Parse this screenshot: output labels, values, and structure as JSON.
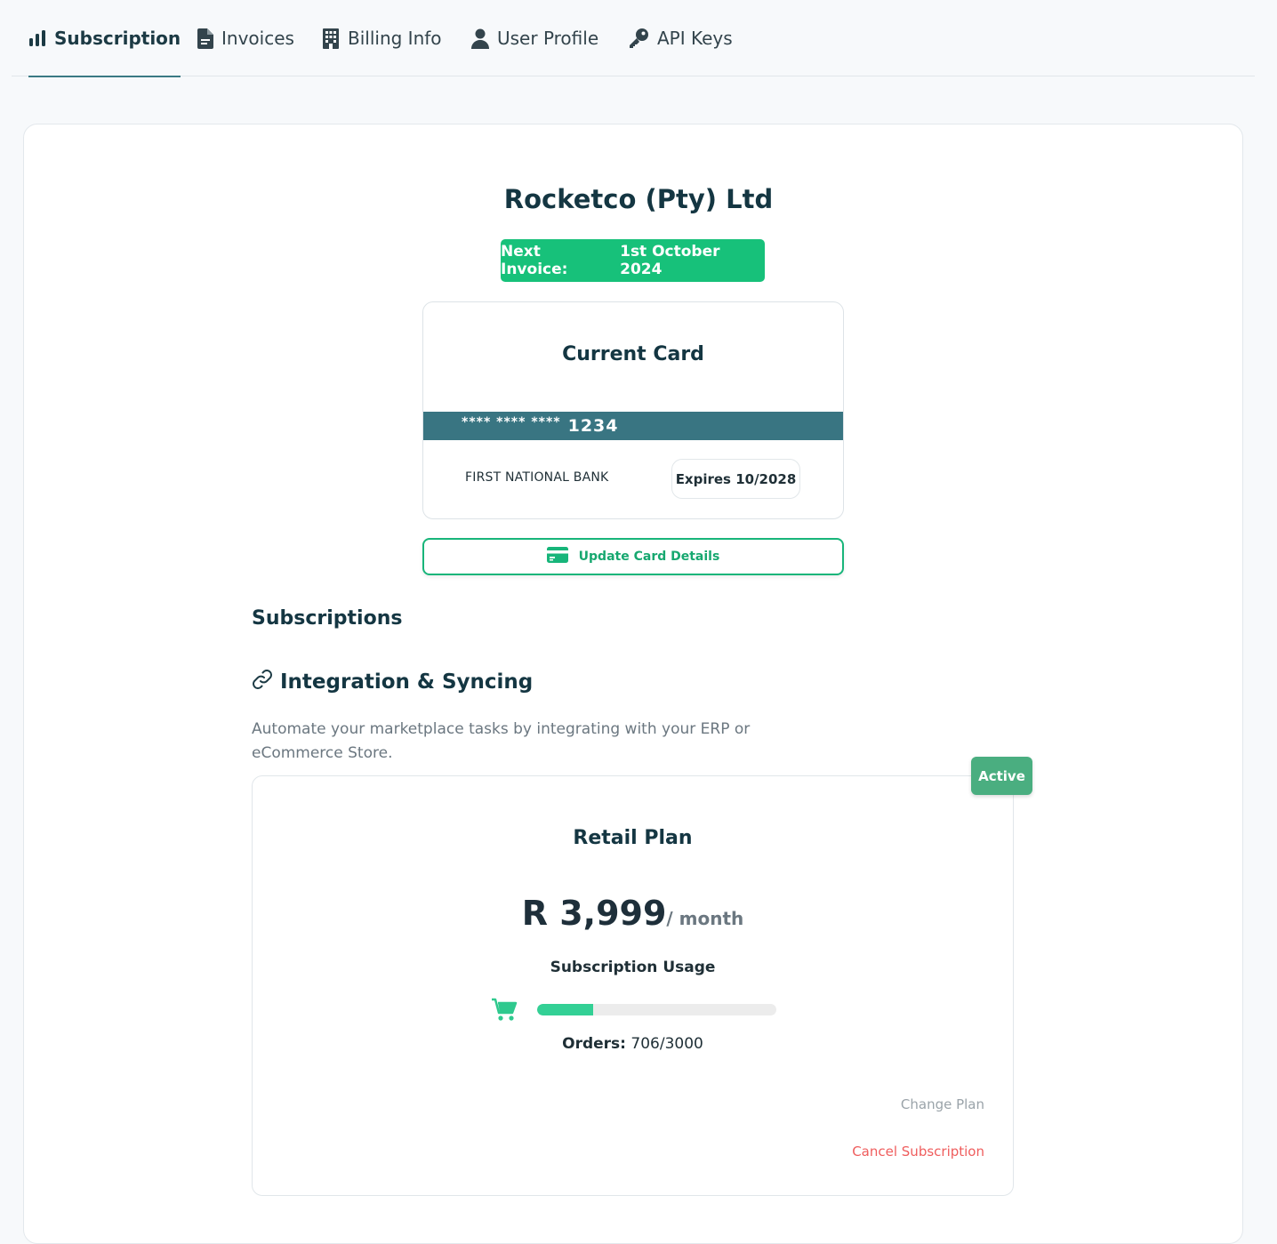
{
  "tabs": [
    {
      "label": "Subscription",
      "icon": "bar-chart-icon",
      "active": true
    },
    {
      "label": "Invoices",
      "icon": "document-icon",
      "active": false
    },
    {
      "label": "Billing Info",
      "icon": "building-icon",
      "active": false
    },
    {
      "label": "User Profile",
      "icon": "user-icon",
      "active": false
    },
    {
      "label": "API Keys",
      "icon": "key-icon",
      "active": false
    }
  ],
  "company": {
    "name": "Rocketco (Pty) Ltd"
  },
  "next_invoice": {
    "label": "Next Invoice:",
    "date": "1st October 2024"
  },
  "card": {
    "title": "Current Card",
    "mask": "**** **** ****",
    "last4": "1234",
    "bank": "FIRST NATIONAL BANK",
    "expiry": "Expires 10/2028"
  },
  "update_button": {
    "label": "Update Card Details",
    "icon": "credit-card-icon"
  },
  "subscriptions": {
    "heading": "Subscriptions"
  },
  "integration": {
    "title": "Integration & Syncing",
    "icon": "link-icon",
    "description": "Automate your marketplace tasks by integrating with your ERP or eCommerce Store."
  },
  "plan": {
    "status": "Active",
    "name": "Retail Plan",
    "price": "R 3,999",
    "period": "/ month",
    "usage_title": "Subscription Usage",
    "usage_icon": "shopping-cart-icon",
    "orders_label": "Orders:",
    "orders_value": "706/3000",
    "orders_used": 706,
    "orders_limit": 3000,
    "change_plan_label": "Change Plan",
    "cancel_label": "Cancel Subscription"
  },
  "colors": {
    "accent": "#17c17a",
    "strip": "#397582",
    "active_badge": "#4aae80",
    "danger": "#ef5d5d"
  }
}
